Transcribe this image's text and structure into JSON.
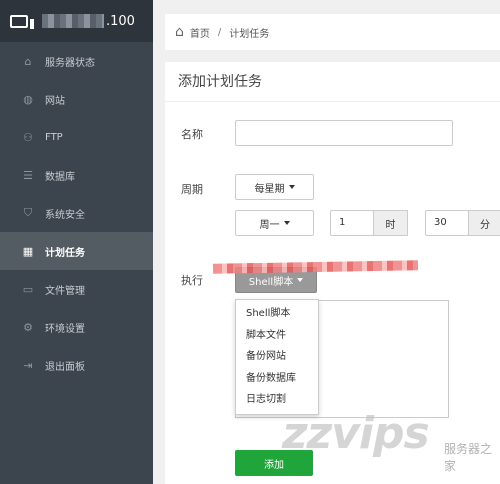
{
  "server": {
    "ip_suffix": ".100"
  },
  "sidebar": {
    "items": [
      {
        "label": "服务器状态",
        "icon": "home-icon"
      },
      {
        "label": "网站",
        "icon": "globe-icon"
      },
      {
        "label": "FTP",
        "icon": "ftp-icon"
      },
      {
        "label": "数据库",
        "icon": "database-icon"
      },
      {
        "label": "系统安全",
        "icon": "shield-icon"
      },
      {
        "label": "计划任务",
        "icon": "calendar-icon",
        "active": true
      },
      {
        "label": "文件管理",
        "icon": "folder-icon"
      },
      {
        "label": "环境设置",
        "icon": "gear-icon"
      },
      {
        "label": "退出面板",
        "icon": "logout-icon"
      }
    ]
  },
  "breadcrumb": {
    "home": "首页",
    "separator": "/",
    "current": "计划任务"
  },
  "form": {
    "title": "添加计划任务",
    "name_label": "名称",
    "name_value": "",
    "period_label": "周期",
    "period_value": "每星期",
    "weekday_value": "周一",
    "hour_value": "1",
    "hour_unit": "时",
    "minute_value": "30",
    "minute_unit": "分",
    "exec_label": "执行",
    "exec_value": "Shell脚本",
    "exec_options": [
      "Shell脚本",
      "脚本文件",
      "备份网站",
      "备份数据库",
      "日志切割"
    ],
    "submit_label": "添加"
  },
  "watermark": {
    "main": "zzvips",
    "sub": "服务器之家"
  },
  "colors": {
    "sidebar_bg": "#3c444d",
    "active_bg": "#535b63",
    "accent_green": "#20a53a",
    "exec_button_bg": "#999999"
  }
}
